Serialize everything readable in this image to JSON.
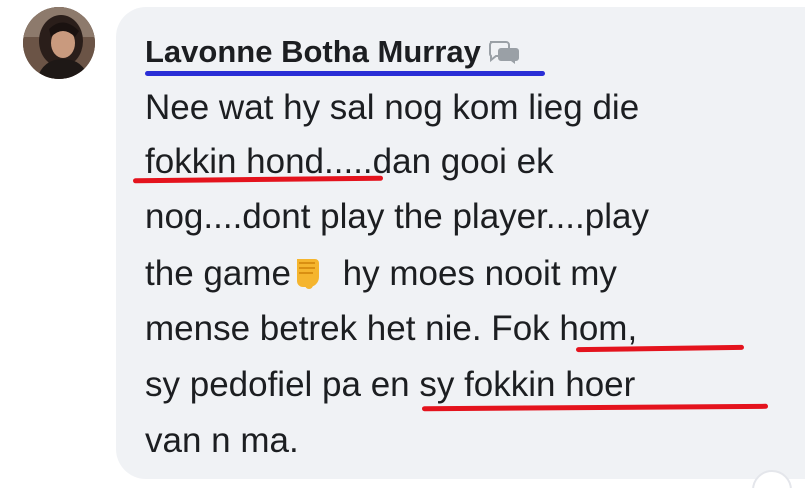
{
  "comment": {
    "author": "Lavonne Botha Murray",
    "lines": [
      "Nee wat hy sal nog kom lieg die",
      "fokkin hond.....dan gooi ek",
      "nog....dont play the player....play",
      "the game",
      " hy moes nooit my",
      "mense betrek het nie. Fok hom,",
      "sy pedofiel pa en sy fokkin hoer",
      "van n ma."
    ]
  },
  "icons": {
    "avatar": "avatar-photo",
    "author_badge": "chat-bubbles-icon",
    "emoji": "backhand-index-pointing-down-icon",
    "corner": "reaction-badge"
  },
  "colors": {
    "bubble": "#f0f2f5",
    "text": "#1c1e21",
    "annotation_blue": "#2a2ed6",
    "annotation_red": "#e4131d"
  }
}
